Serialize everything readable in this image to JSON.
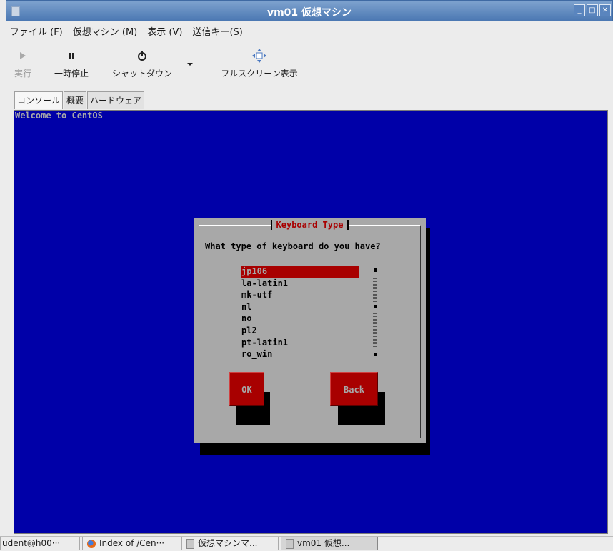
{
  "window": {
    "title": "vm01 仮想マシン"
  },
  "menu": [
    "ファイル (F)",
    "仮想マシン (M)",
    "表示 (V)",
    "送信キー(S)"
  ],
  "toolbar": {
    "run_label": "実行",
    "pause_label": "一時停止",
    "shutdown_label": "シャットダウン",
    "fullscreen_label": "フルスクリーン表示"
  },
  "tabs": [
    "コンソール",
    "概要",
    "ハードウェア"
  ],
  "console": {
    "welcome": "Welcome to CentOS",
    "dialog": {
      "title": "Keyboard Type",
      "question": "What type of keyboard do you have?",
      "options": [
        "jp106",
        "la-latin1",
        "mk-utf",
        "nl",
        "no",
        "pl2",
        "pt-latin1",
        "ro_win"
      ],
      "selected": "jp106",
      "ok_label": "OK",
      "back_label": "Back"
    }
  },
  "taskbar": [
    "udent@h00···",
    "Index of /Cen···",
    "仮想マシンマ...",
    "vm01 仮想..."
  ],
  "colors": {
    "console_bg": "#0000a8",
    "dialog_bg": "#a8a8a8",
    "accent_red": "#a80000"
  }
}
